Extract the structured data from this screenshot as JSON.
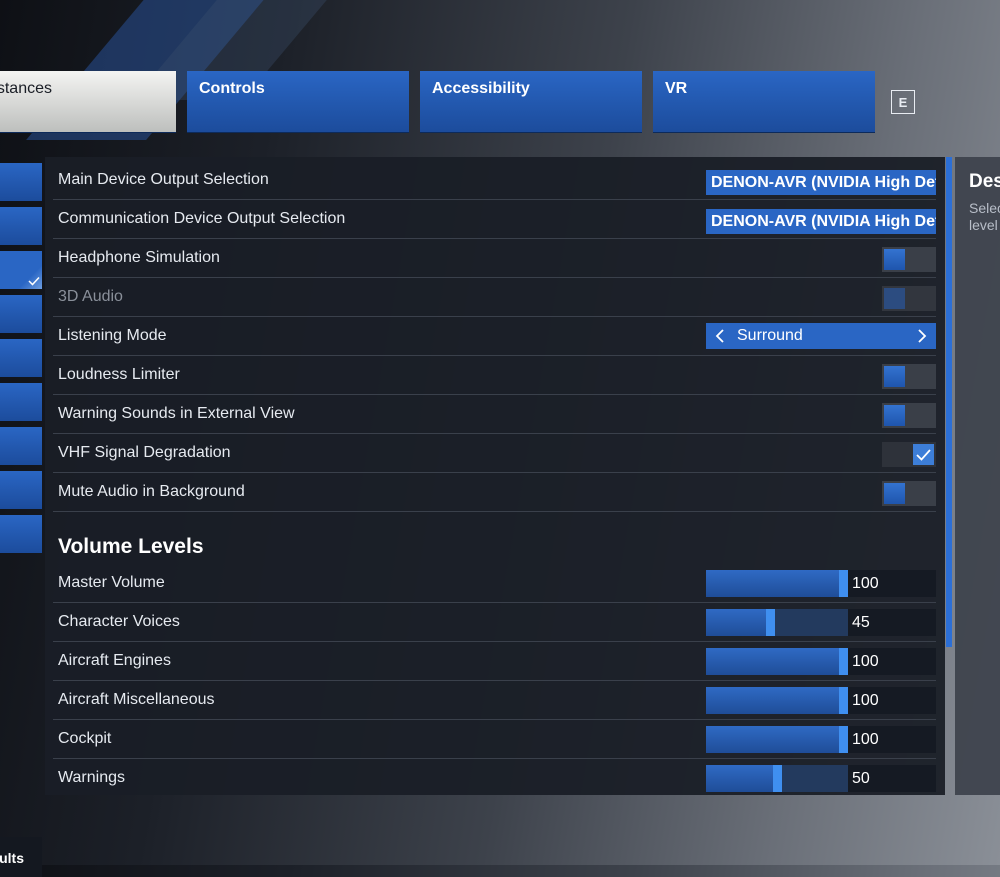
{
  "tabs": [
    {
      "label": "Assistances"
    },
    {
      "label": "Controls"
    },
    {
      "label": "Accessibility"
    },
    {
      "label": "VR"
    }
  ],
  "tab_key_hint": "E",
  "settings": [
    {
      "label": "Main Device Output Selection",
      "value": "DENON-AVR (NVIDIA High Definition Audio)"
    },
    {
      "label": "Communication Device Output Selection",
      "value": "DENON-AVR (NVIDIA High Definition Audio)"
    },
    {
      "label": "Headphone Simulation",
      "state": "off"
    },
    {
      "label": "3D Audio",
      "state": "off-disabled"
    },
    {
      "label": "Listening Mode",
      "value": "Surround"
    },
    {
      "label": "Loudness Limiter",
      "state": "off"
    },
    {
      "label": "Warning Sounds in External View",
      "state": "off"
    },
    {
      "label": "VHF Signal Degradation",
      "state": "on"
    },
    {
      "label": "Mute Audio in Background",
      "state": "off"
    }
  ],
  "volume_section": {
    "title": "Volume Levels"
  },
  "volumes": [
    {
      "label": "Master Volume",
      "value": 100
    },
    {
      "label": "Character Voices",
      "value": 45
    },
    {
      "label": "Aircraft Engines",
      "value": 100
    },
    {
      "label": "Aircraft Miscellaneous",
      "value": 100
    },
    {
      "label": "Cockpit",
      "value": 100
    },
    {
      "label": "Warnings",
      "value": 50
    }
  ],
  "description": {
    "title": "Des",
    "line1": "Selec",
    "line2": "level"
  },
  "bottom_button": {
    "label": "ults"
  },
  "colors": {
    "accent": "#2a66c4",
    "handle": "#3f8ff0",
    "panel": "#1a1e26"
  }
}
